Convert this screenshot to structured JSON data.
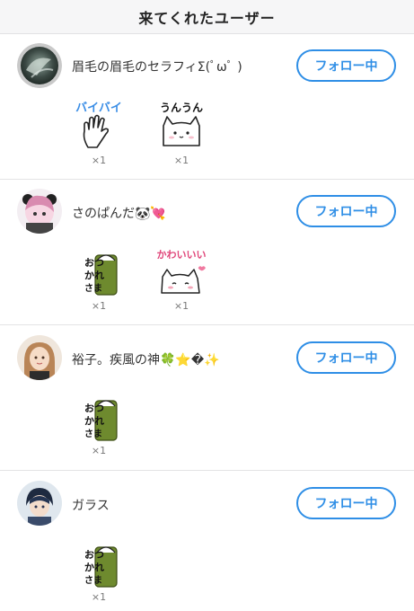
{
  "header": {
    "title": "来てくれたユーザー"
  },
  "users": [
    {
      "name": "眉毛の眉毛のセラフィΣ(ﾟωﾟ )",
      "follow_label": "フォロー中",
      "stamps": [
        {
          "icon": "byebye-hand-stamp",
          "label": "バイバイ",
          "count": "×1"
        },
        {
          "icon": "unun-cat-stamp",
          "label": "うんうん",
          "count": "×1"
        }
      ]
    },
    {
      "name": "さのぱんだ🐼💘",
      "follow_label": "フォロー中",
      "stamps": [
        {
          "icon": "otsukare-cat-stamp",
          "label": "おつかれさま",
          "count": "×1"
        },
        {
          "icon": "kawaii-cat-stamp",
          "label": "かわいいい",
          "count": "×1"
        }
      ]
    },
    {
      "name": "裕子。疾風の神🍀⭐️�✨",
      "follow_label": "フォロー中",
      "stamps": [
        {
          "icon": "otsukare-cat-stamp",
          "label": "おつかれさま",
          "count": "×1"
        }
      ]
    },
    {
      "name": "ガラス",
      "follow_label": "フォロー中",
      "stamps": [
        {
          "icon": "otsukare-cat-stamp",
          "label": "おつかれさま",
          "count": "×1"
        }
      ]
    }
  ],
  "colors": {
    "accent": "#2e8ee6",
    "divider": "#e3e3e5",
    "header_bg": "#f6f6f7"
  }
}
